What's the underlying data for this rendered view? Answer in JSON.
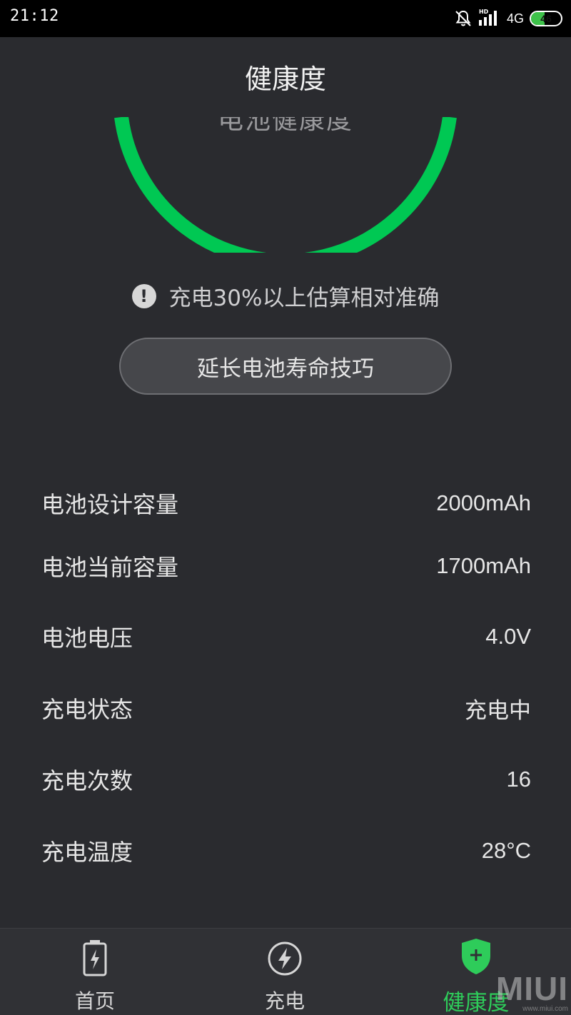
{
  "status_bar": {
    "time": "21:12",
    "hd_label": "HD",
    "network": "4G",
    "battery_level": "46",
    "battery_fraction": 0.46
  },
  "page": {
    "title": "健康度"
  },
  "ring": {
    "caption": "电池健康度",
    "color": "#00c853"
  },
  "notice": {
    "icon": "exclamation-icon",
    "text": "充电30%以上估算相对准确"
  },
  "tips_button": {
    "label": "延长电池寿命技巧"
  },
  "info_rows": [
    {
      "label": "电池设计容量",
      "value": "2000mAh"
    },
    {
      "label": "电池当前容量",
      "value": "1700mAh"
    },
    {
      "label": "电池电压",
      "value": "4.0V"
    },
    {
      "label": "充电状态",
      "value": "充电中"
    },
    {
      "label": "充电次数",
      "value": "16"
    },
    {
      "label": "充电温度",
      "value": "28°C"
    }
  ],
  "bottom_nav": {
    "items": [
      {
        "label": "首页",
        "icon": "battery-icon",
        "active": false
      },
      {
        "label": "充电",
        "icon": "lightning-icon",
        "active": false
      },
      {
        "label": "健康度",
        "icon": "shield-plus-icon",
        "active": true
      }
    ],
    "active_color": "#2ecc5a"
  },
  "watermark": {
    "brand": "MIUI",
    "url": "www.miui.com"
  }
}
